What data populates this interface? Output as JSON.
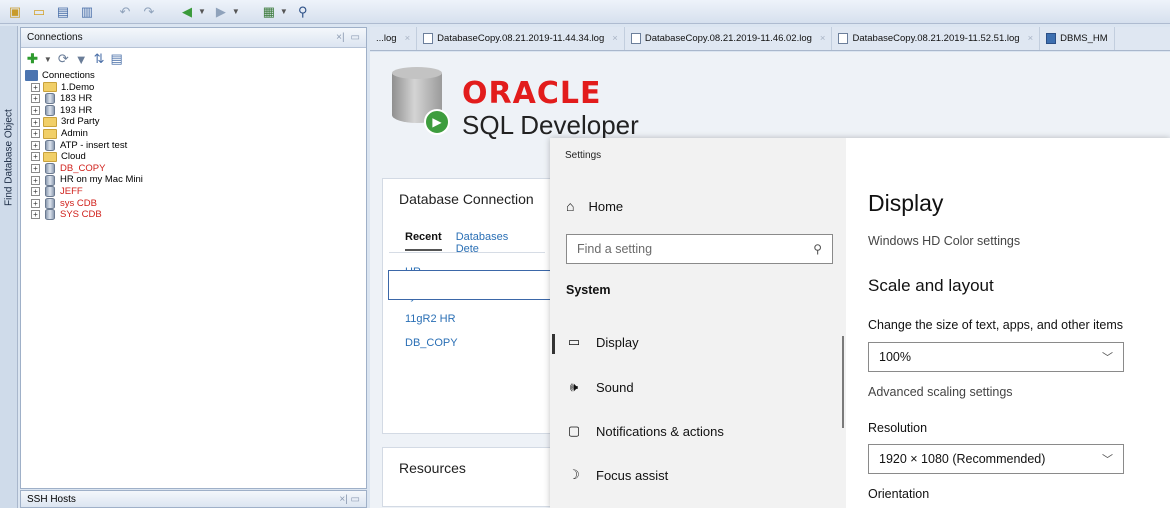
{
  "toolbar": {
    "icons": [
      "new-icon",
      "open-icon",
      "save-icon",
      "save-all-icon",
      "undo-icon",
      "redo-icon",
      "back-icon",
      "forward-icon",
      "sql-worksheet-icon",
      "find-db-object-icon"
    ]
  },
  "side_strip": {
    "label": "Find Database Object"
  },
  "connections": {
    "title": "Connections",
    "root": "Connections",
    "items": [
      {
        "label": "1.Demo",
        "type": "folder",
        "color": "normal"
      },
      {
        "label": "183 HR",
        "type": "db",
        "color": "normal"
      },
      {
        "label": "193 HR",
        "type": "db",
        "color": "normal"
      },
      {
        "label": "3rd Party",
        "type": "folder",
        "color": "normal"
      },
      {
        "label": "Admin",
        "type": "folder",
        "color": "normal"
      },
      {
        "label": "ATP - insert test",
        "type": "db",
        "color": "normal"
      },
      {
        "label": "Cloud",
        "type": "folder",
        "color": "normal"
      },
      {
        "label": "DB_COPY",
        "type": "db",
        "color": "red"
      },
      {
        "label": "HR on my Mac Mini",
        "type": "db",
        "color": "normal"
      },
      {
        "label": "JEFF",
        "type": "db",
        "color": "red"
      },
      {
        "label": "sys CDB",
        "type": "db",
        "color": "red"
      },
      {
        "label": "SYS CDB",
        "type": "db",
        "color": "red"
      }
    ]
  },
  "ssh": {
    "title": "SSH Hosts"
  },
  "tabs": [
    {
      "label": "...log"
    },
    {
      "label": "DatabaseCopy.08.21.2019-11.44.34.log"
    },
    {
      "label": "DatabaseCopy.08.21.2019-11.46.02.log"
    },
    {
      "label": "DatabaseCopy.08.21.2019-11.52.51.log"
    },
    {
      "label": "DBMS_HM"
    }
  ],
  "brand": {
    "oracle": "ORACLE",
    "product": "SQL Developer"
  },
  "db_connection": {
    "title": "Database Connection",
    "tab_recent": "Recent",
    "tab_databases": "Databases Dete",
    "recent": [
      "HR",
      "sys",
      "11gR2 HR",
      "DB_COPY"
    ]
  },
  "resources": {
    "title": "Resources"
  },
  "settings": {
    "window_title": "Settings",
    "home": "Home",
    "search_placeholder": "Find a setting",
    "section": "System",
    "nav": [
      {
        "label": "Display",
        "icon": "monitor-icon"
      },
      {
        "label": "Sound",
        "icon": "speaker-icon"
      },
      {
        "label": "Notifications & actions",
        "icon": "notification-icon"
      },
      {
        "label": "Focus assist",
        "icon": "moon-icon"
      }
    ],
    "page_title": "Display",
    "hd_color_link": "Windows HD Color settings",
    "scale_layout": "Scale and layout",
    "scale_label": "Change the size of text, apps, and other items",
    "scale_value": "100%",
    "advanced_scaling": "Advanced scaling settings",
    "resolution_label": "Resolution",
    "resolution_value": "1920 × 1080 (Recommended)",
    "orientation_label": "Orientation"
  }
}
